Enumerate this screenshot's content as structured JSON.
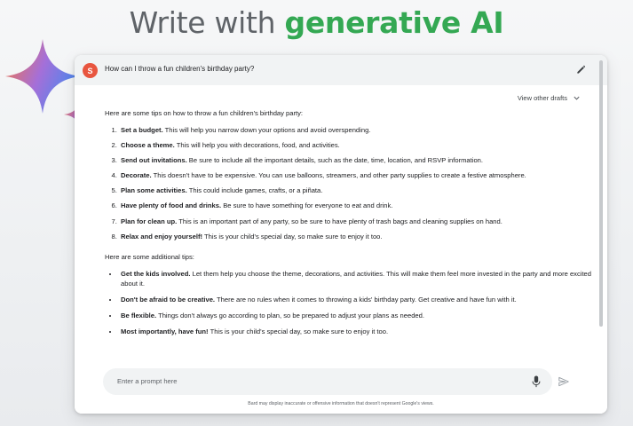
{
  "headline": {
    "prefix": "Write with ",
    "accent": "generative AI"
  },
  "query": {
    "avatar_initial": "S",
    "text": "How can I throw a fun children's birthday party?"
  },
  "drafts_label": "View other drafts",
  "response": {
    "intro": "Here are some tips on how to throw a fun children's birthday party:",
    "tips": [
      {
        "bold": "Set a budget.",
        "text": " This will help you narrow down your options and avoid overspending."
      },
      {
        "bold": "Choose a theme.",
        "text": " This will help you with decorations, food, and activities."
      },
      {
        "bold": "Send out invitations.",
        "text": " Be sure to include all the important details, such as the date, time, location, and RSVP information."
      },
      {
        "bold": "Decorate.",
        "text": " This doesn't have to be expensive. You can use balloons, streamers, and other party supplies to create a festive atmosphere."
      },
      {
        "bold": "Plan some activities.",
        "text": " This could include games, crafts, or a piñata."
      },
      {
        "bold": "Have plenty of food and drinks.",
        "text": " Be sure to have something for everyone to eat and drink."
      },
      {
        "bold": "Plan for clean up.",
        "text": " This is an important part of any party, so be sure to have plenty of trash bags and cleaning supplies on hand."
      },
      {
        "bold": "Relax and enjoy yourself!",
        "text": " This is your child's special day, so make sure to enjoy it too."
      }
    ],
    "additional_intro": "Here are some additional tips:",
    "additional": [
      {
        "bold": "Get the kids involved.",
        "text": " Let them help you choose the theme, decorations, and activities. This will make them feel more invested in the party and more excited about it."
      },
      {
        "bold": "Don't be afraid to be creative.",
        "text": " There are no rules when it comes to throwing a kids' birthday party. Get creative and have fun with it."
      },
      {
        "bold": "Be flexible.",
        "text": " Things don't always go according to plan, so be prepared to adjust your plans as needed."
      },
      {
        "bold": "Most importantly, have fun!",
        "text": " This is your child's special day, so make sure to enjoy it too."
      }
    ]
  },
  "prompt": {
    "placeholder": "Enter a prompt here"
  },
  "disclaimer": "Bard may display inaccurate or offensive information that doesn't represent Google's views.",
  "colors": {
    "accent_green": "#34a853",
    "avatar": "#e8553f",
    "spark_blue": "#4f7ff0",
    "spark_purple": "#a56fd8",
    "spark_orange": "#e8735a"
  },
  "icons": [
    "sparkle-icon",
    "edit-pencil-icon",
    "chevron-down-icon",
    "microphone-icon",
    "send-icon"
  ]
}
